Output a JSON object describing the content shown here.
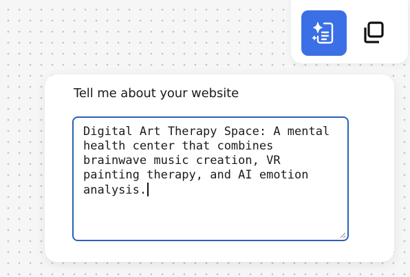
{
  "toolbar": {
    "ai_button_icon": "ai-sparkle-document-icon",
    "copy_button_icon": "copy-icon",
    "accent_color": "#3a6fe6"
  },
  "prompt": {
    "label": "Tell me about your website",
    "value": "Digital Art Therapy Space: A mental health center that combines brainwave music creation, VR painting therapy, and AI emotion analysis.",
    "focus_color": "#2a5fb8"
  }
}
